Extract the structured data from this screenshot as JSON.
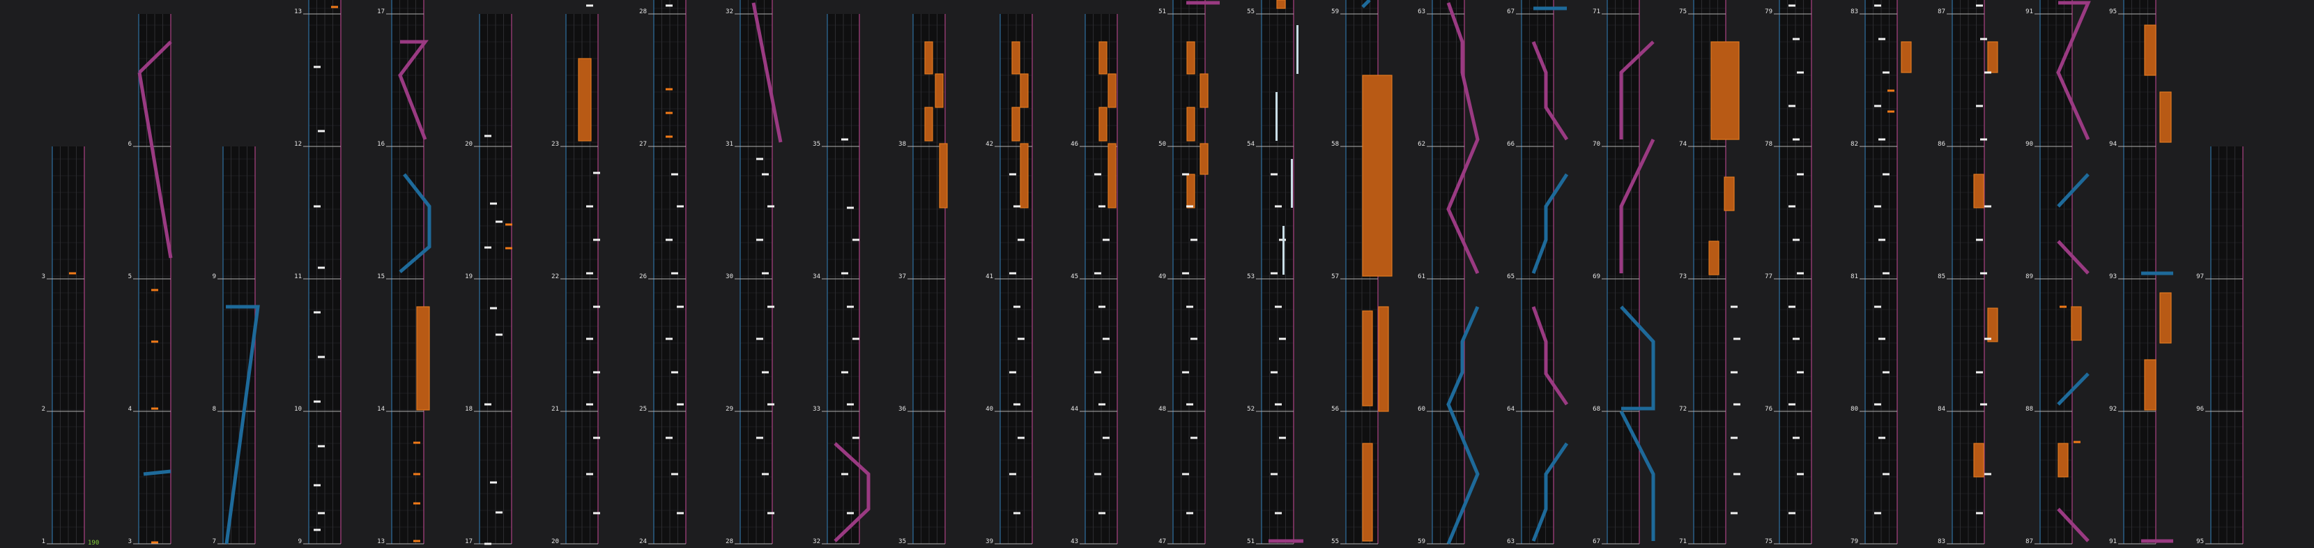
{
  "editor": {
    "name": "rhythm-chart-editor",
    "combo_label": "190",
    "measure_numbers": [
      "1",
      "2",
      "3",
      "4",
      "5",
      "6",
      "7",
      "8",
      "9",
      "10",
      "11",
      "12",
      "13",
      "14",
      "15",
      "16",
      "17",
      "18",
      "19",
      "20",
      "21",
      "22",
      "23",
      "24",
      "25",
      "26",
      "27",
      "28",
      "29",
      "30",
      "31",
      "32",
      "33",
      "34",
      "35",
      "36",
      "37",
      "38",
      "39",
      "40",
      "41",
      "42",
      "43",
      "44",
      "45",
      "46",
      "47",
      "48",
      "49",
      "50",
      "51",
      "52",
      "53",
      "54",
      "55",
      "56",
      "57",
      "58",
      "59",
      "60",
      "61",
      "62",
      "63",
      "64",
      "65",
      "66",
      "67",
      "68",
      "69",
      "70",
      "71",
      "72",
      "73",
      "74",
      "75",
      "76",
      "77",
      "78",
      "79",
      "80",
      "81",
      "82",
      "83",
      "84",
      "85",
      "86",
      "87",
      "88",
      "89",
      "90",
      "91",
      "92",
      "93",
      "94",
      "95",
      "96",
      "97"
    ]
  },
  "colors": {
    "background": "#1d1d1f",
    "lane_background": "#0f0f10",
    "grid_line": "#2c2c30",
    "left_border": "#2a5f86",
    "right_border": "#8e3a6f",
    "measure_line": "#b0b0b0",
    "tap_note": "#f2f2f2",
    "orange_note": "#f07a18",
    "hold_fill": "#b85a15",
    "hold_border": "#e07820",
    "slide_blue": "#1e6a9a",
    "slide_pink": "#9a3a82",
    "long_white": "#c8dde6",
    "combo_text": "#86d23c",
    "label_text": "#e6e6e6"
  }
}
